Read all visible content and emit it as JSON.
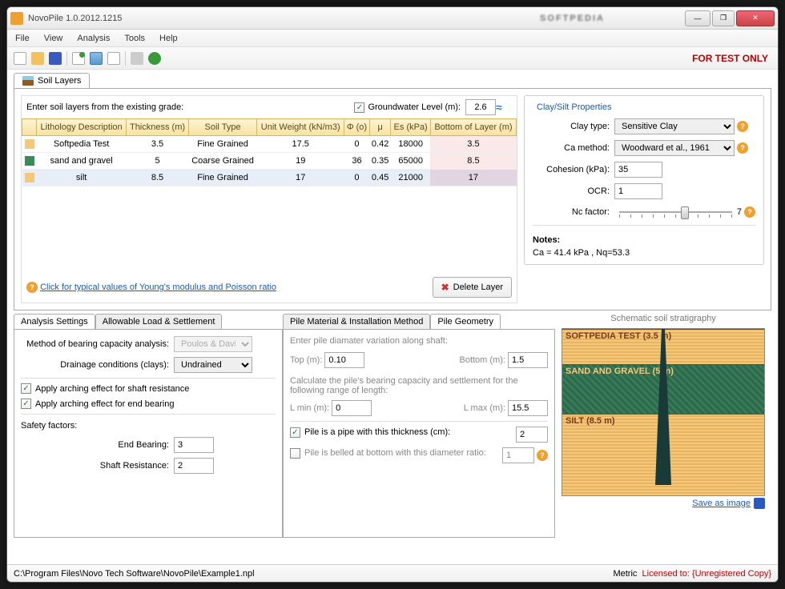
{
  "window": {
    "title": "NovoPile 1.0.2012.1215",
    "watermark": "SOFTPEDIA"
  },
  "window_controls": {
    "min": "—",
    "max": "❐",
    "close": "✕"
  },
  "menu": {
    "file": "File",
    "view": "View",
    "analysis": "Analysis",
    "tools": "Tools",
    "help": "Help"
  },
  "toolbar": {
    "test_only": "FOR TEST ONLY"
  },
  "tabs": {
    "soil_layers": "Soil Layers"
  },
  "soil_layers": {
    "instruction": "Enter soil layers from the existing grade:",
    "groundwater_label": "Groundwater Level (m):",
    "groundwater_value": "2.6",
    "columns": {
      "lithology": "Lithology Description",
      "thickness": "Thickness (m)",
      "soil_type": "Soil Type",
      "unit_weight": "Unit Weight (kN/m3)",
      "phi": "Φ (o)",
      "mu": "μ",
      "es": "Es (kPa)",
      "bottom": "Bottom of Layer (m)"
    },
    "rows": [
      {
        "color": "#f4c77a",
        "lithology": "Softpedia Test",
        "thickness": "3.5",
        "soil_type": "Fine Grained",
        "unit_weight": "17.5",
        "phi": "0",
        "mu": "0.42",
        "es": "18000",
        "bottom": "3.5"
      },
      {
        "color": "#3a8a5a",
        "lithology": "sand and gravel",
        "thickness": "5",
        "soil_type": "Coarse Grained",
        "unit_weight": "19",
        "phi": "36",
        "mu": "0.35",
        "es": "65000",
        "bottom": "8.5"
      },
      {
        "color": "#f4c77a",
        "lithology": "silt",
        "thickness": "8.5",
        "soil_type": "Fine Grained",
        "unit_weight": "17",
        "phi": "0",
        "mu": "0.45",
        "es": "21000",
        "bottom": "17"
      }
    ],
    "link": "Click for typical values of Young's modulus and Poisson ratio",
    "delete_btn": "Delete Layer"
  },
  "props": {
    "title": "Clay/Silt Properties",
    "clay_type_label": "Clay type:",
    "clay_type_value": "Sensitive Clay",
    "ca_method_label": "Ca method:",
    "ca_method_value": "Woodward et al., 1961",
    "cohesion_label": "Cohesion (kPa):",
    "cohesion_value": "35",
    "ocr_label": "OCR:",
    "ocr_value": "1",
    "nc_label": "Nc factor:",
    "nc_value": "7",
    "notes_title": "Notes:",
    "notes_text": "Ca = 41.4 kPa  ,  Nq=53.3"
  },
  "analysis": {
    "tabs": {
      "settings": "Analysis Settings",
      "allowable": "Allowable Load & Settlement"
    },
    "method_label": "Method of bearing capacity analysis:",
    "method_value": "Poulos & Davis",
    "drainage_label": "Drainage conditions (clays):",
    "drainage_value": "Undrained",
    "arch_shaft": "Apply arching effect for shaft resistance",
    "arch_end": "Apply arching effect for end bearing",
    "sf_title": "Safety factors:",
    "end_bearing_label": "End Bearing:",
    "end_bearing_value": "3",
    "shaft_res_label": "Shaft Resistance:",
    "shaft_res_value": "2"
  },
  "pile": {
    "tabs": {
      "material": "Pile Material & Installation Method",
      "geometry": "Pile Geometry"
    },
    "diam_intro": "Enter pile diamater variation along shaft:",
    "top_label": "Top (m):",
    "top_value": "0.10",
    "bottom_label": "Bottom (m):",
    "bottom_value": "1.5",
    "length_intro": "Calculate the pile's bearing capacity and settlement for the following range of length:",
    "lmin_label": "L min (m):",
    "lmin_value": "0",
    "lmax_label": "L max (m):",
    "lmax_value": "15.5",
    "pipe_label": "Pile is a pipe with this thickness (cm):",
    "pipe_value": "2",
    "belled_label": "Pile is belled at bottom with this diameter ratio:",
    "belled_value": "1"
  },
  "strat": {
    "title": "Schematic soil stratigraphy",
    "l1": "SOFTPEDIA TEST (3.5 m)",
    "l2": "SAND AND GRAVEL (5 m)",
    "l3": "SILT (8.5 m)",
    "save_link": "Save as image"
  },
  "status": {
    "path": "C:\\Program Files\\Novo Tech Software\\NovoPile\\Example1.npl",
    "metric": "Metric",
    "license_label": "Licensed to:",
    "license_value": "{Unregistered Copy}"
  }
}
